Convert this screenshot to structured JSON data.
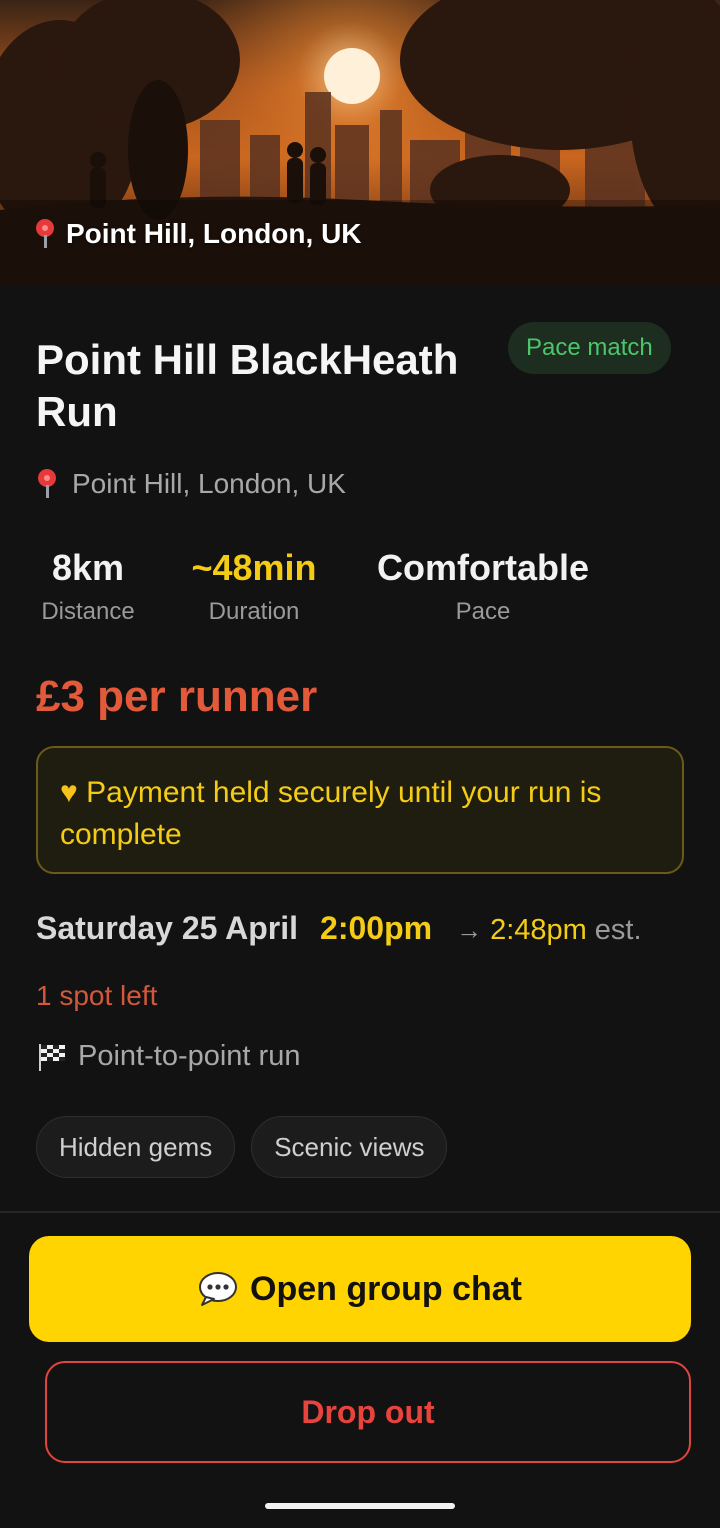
{
  "hero": {
    "location": "Point Hill, London, UK"
  },
  "run": {
    "title": "Point Hill BlackHeath Run",
    "badge": "Pace match",
    "location": "Point Hill, London, UK"
  },
  "stats": [
    {
      "value": "8km",
      "label": "Distance"
    },
    {
      "value": "~48min",
      "label": "Duration"
    },
    {
      "value": "Comfortable",
      "label": "Pace"
    }
  ],
  "price": "£3 per runner",
  "notice": {
    "icon": "yellow-heart",
    "text": "Payment held securely until your run is complete"
  },
  "schedule": {
    "day": "Saturday 25 April",
    "start": "2:00pm",
    "arrow": "→",
    "end": "2:48pm",
    "est": "est."
  },
  "spots_left": "1 spot left",
  "route_type": "Point-to-point run",
  "tags": [
    "Hidden gems",
    "Scenic views"
  ],
  "buttons": {
    "chat": "Open group chat",
    "drop": "Drop out"
  },
  "colors": {
    "accent": "#ffd400",
    "price": "#e25a3a",
    "badge_text": "#4cc66a",
    "danger": "#e0443c"
  }
}
